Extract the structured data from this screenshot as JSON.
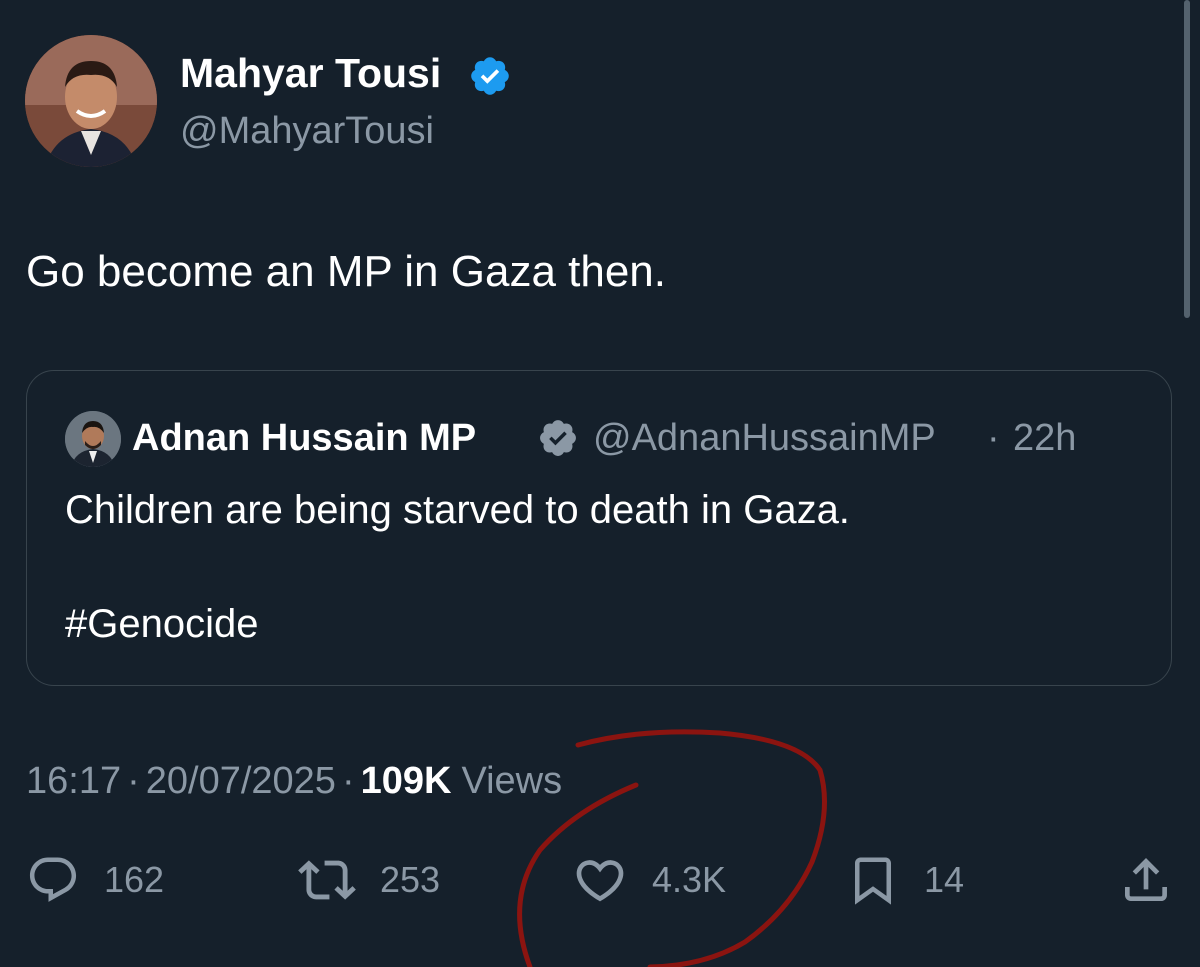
{
  "tweet": {
    "author": {
      "name": "Mahyar Tousi",
      "handle": "@MahyarTousi",
      "verified": true
    },
    "text": "Go become an MP in Gaza then.",
    "quoted": {
      "author_name": "Adnan Hussain MP",
      "handle": "@AdnanHussainMP",
      "separator": "·",
      "time": "22h",
      "verified": true,
      "line1": "Children are being starved to death in Gaza.",
      "line2": "#Genocide"
    },
    "meta": {
      "time": "16:17",
      "sep1": "·",
      "date": "20/07/2025",
      "sep2": "·",
      "views_count": "109K",
      "views_label": "Views"
    },
    "actions": {
      "replies": "162",
      "reposts": "253",
      "likes": "4.3K",
      "bookmarks": "14"
    }
  },
  "icons": {
    "reply": "speech-bubble",
    "repost": "repost-arrows",
    "like": "heart-outline",
    "bookmark": "bookmark-outline",
    "share": "share-upload",
    "verified": "verified-badge"
  },
  "colors": {
    "background": "#15202b",
    "text": "#ffffff",
    "secondary_text": "#8b98a5",
    "verified_blue": "#1d9bf0",
    "verified_gray": "#8b98a5",
    "card_border": "#38444d",
    "annotation_red": "#8b1410"
  }
}
